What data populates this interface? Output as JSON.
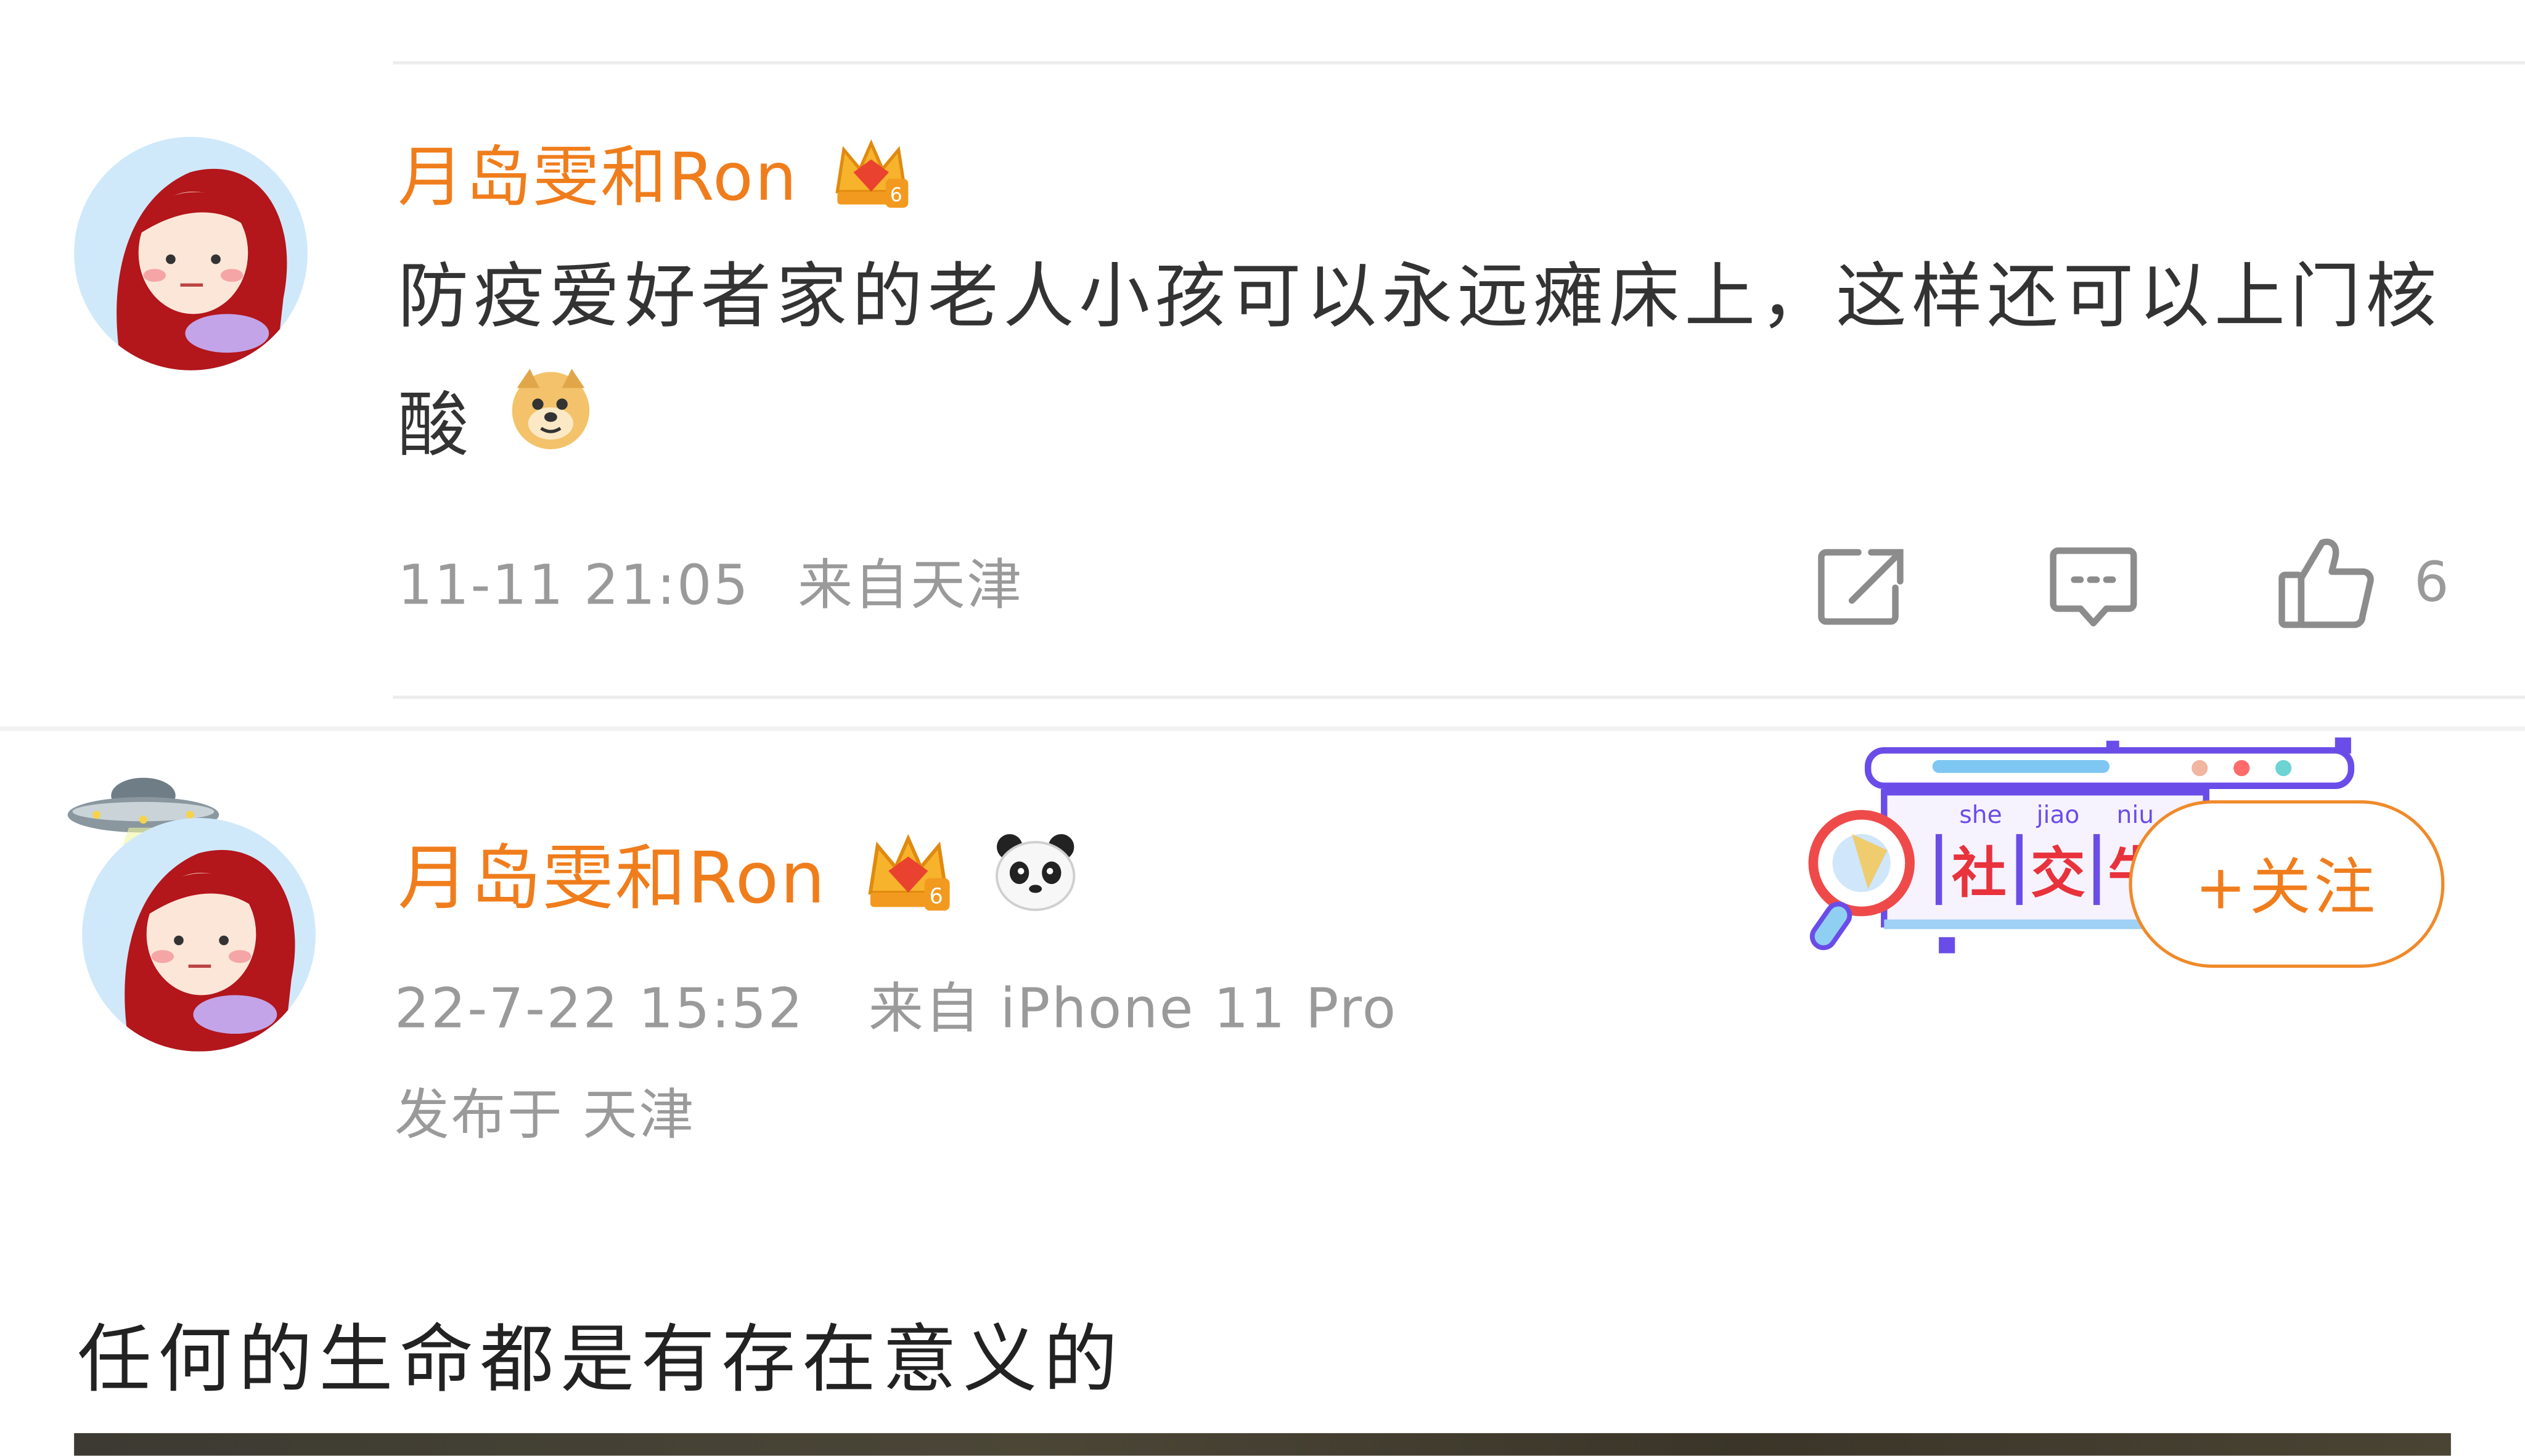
{
  "comment": {
    "username": "月岛雯和Ron",
    "badge_level": "6",
    "text": "防疫爱好者家的老人小孩可以永远瘫床上，这样还可以上门核酸",
    "emoji_icon": "doge-emoji-icon",
    "timestamp": "11-11 21:05",
    "location": "来自天津",
    "like_count": "6"
  },
  "post": {
    "username": "月岛雯和Ron",
    "badge_level": "6",
    "emoji_icon": "panda-emoji-icon",
    "timestamp": "22-7-22 15:52",
    "device": "来自 iPhone 11 Pro",
    "published_in": "发布于 天津",
    "banner": {
      "pinyin": [
        "she",
        "jiao",
        "niu"
      ],
      "chars": [
        "社",
        "交",
        "牛"
      ]
    },
    "follow_label": "+关注",
    "text": "任何的生命都是有存在意义的"
  },
  "colors": {
    "username": "#f07d1c",
    "meta": "#9a9a9a",
    "divider": "#ececec",
    "banner_accent": "#6a4de8"
  }
}
